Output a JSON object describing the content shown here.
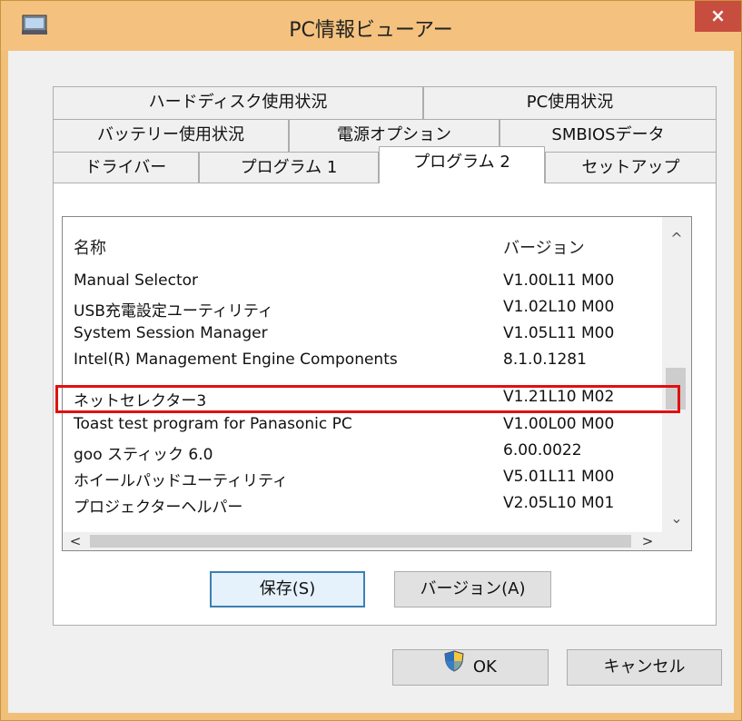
{
  "window": {
    "title": "PC情報ビューアー",
    "close_label": "×"
  },
  "tabs": {
    "row1": [
      "ハードディスク使用状況",
      "PC使用状況"
    ],
    "row2": [
      "バッテリー使用状況",
      "電源オプション",
      "SMBIOSデータ"
    ],
    "row3": [
      "ドライバー",
      "プログラム 1",
      "プログラム 2",
      "セットアップ"
    ],
    "active": "プログラム 2"
  },
  "list": {
    "columns": [
      "名称",
      "バージョン"
    ],
    "rows": [
      [
        "Manual Selector",
        "V1.00L11 M00"
      ],
      [
        "USB充電設定ユーティリティ",
        "V1.02L10 M00"
      ],
      [
        "System Session Manager",
        "V1.05L11 M00"
      ],
      [
        "Intel(R) Management Engine Components",
        "8.1.0.1281"
      ],
      [
        "ネットセレクター3",
        "V1.21L10 M02"
      ],
      [
        "Toast test program for Panasonic PC",
        "V1.00L00 M00"
      ],
      [
        "goo スティック 6.0",
        "6.00.0022"
      ],
      [
        "ホイールパッドユーティリティ",
        "V5.01L11 M00"
      ],
      [
        "プロジェクターヘルパー",
        "V2.05L10 M01"
      ]
    ],
    "highlighted_row": 4
  },
  "scroll_icons": {
    "up": "^",
    "down": "⌄",
    "left": "<",
    "right": ">"
  },
  "buttons": {
    "save": "保存(S)",
    "version": "バージョン(A)",
    "ok": "OK",
    "cancel": "キャンセル"
  },
  "colors": {
    "title_bar": "#f4c27e",
    "close": "#c74d3e",
    "highlight": "#e01010",
    "default_button_border": "#3c7fb1"
  }
}
